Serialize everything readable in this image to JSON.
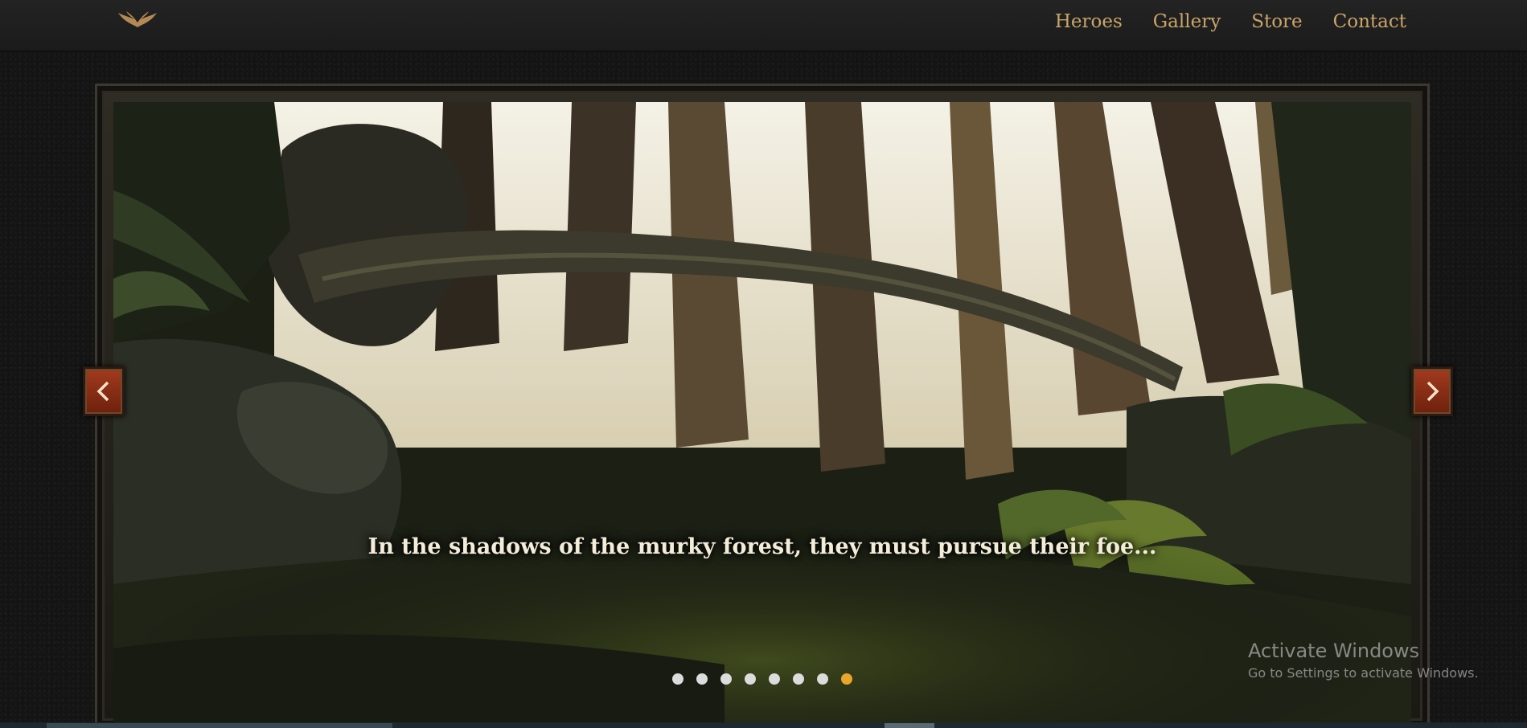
{
  "header": {
    "logo_icon": "wings-logo-icon",
    "nav": [
      {
        "label": "Heroes"
      },
      {
        "label": "Gallery"
      },
      {
        "label": "Store"
      },
      {
        "label": "Contact"
      }
    ]
  },
  "slider": {
    "caption": "In the shadows of the murky forest, they must pursue their foe...",
    "slide_count": 8,
    "active_slide": 8,
    "prev_icon": "chevron-left-icon",
    "next_icon": "chevron-right-icon"
  },
  "watermark": {
    "title": "Activate Windows",
    "subtitle": "Go to Settings to activate Windows."
  },
  "colors": {
    "nav_text": "#c9a56a",
    "dot_active": "#e8a62c",
    "arrow": "#a23b1e"
  }
}
